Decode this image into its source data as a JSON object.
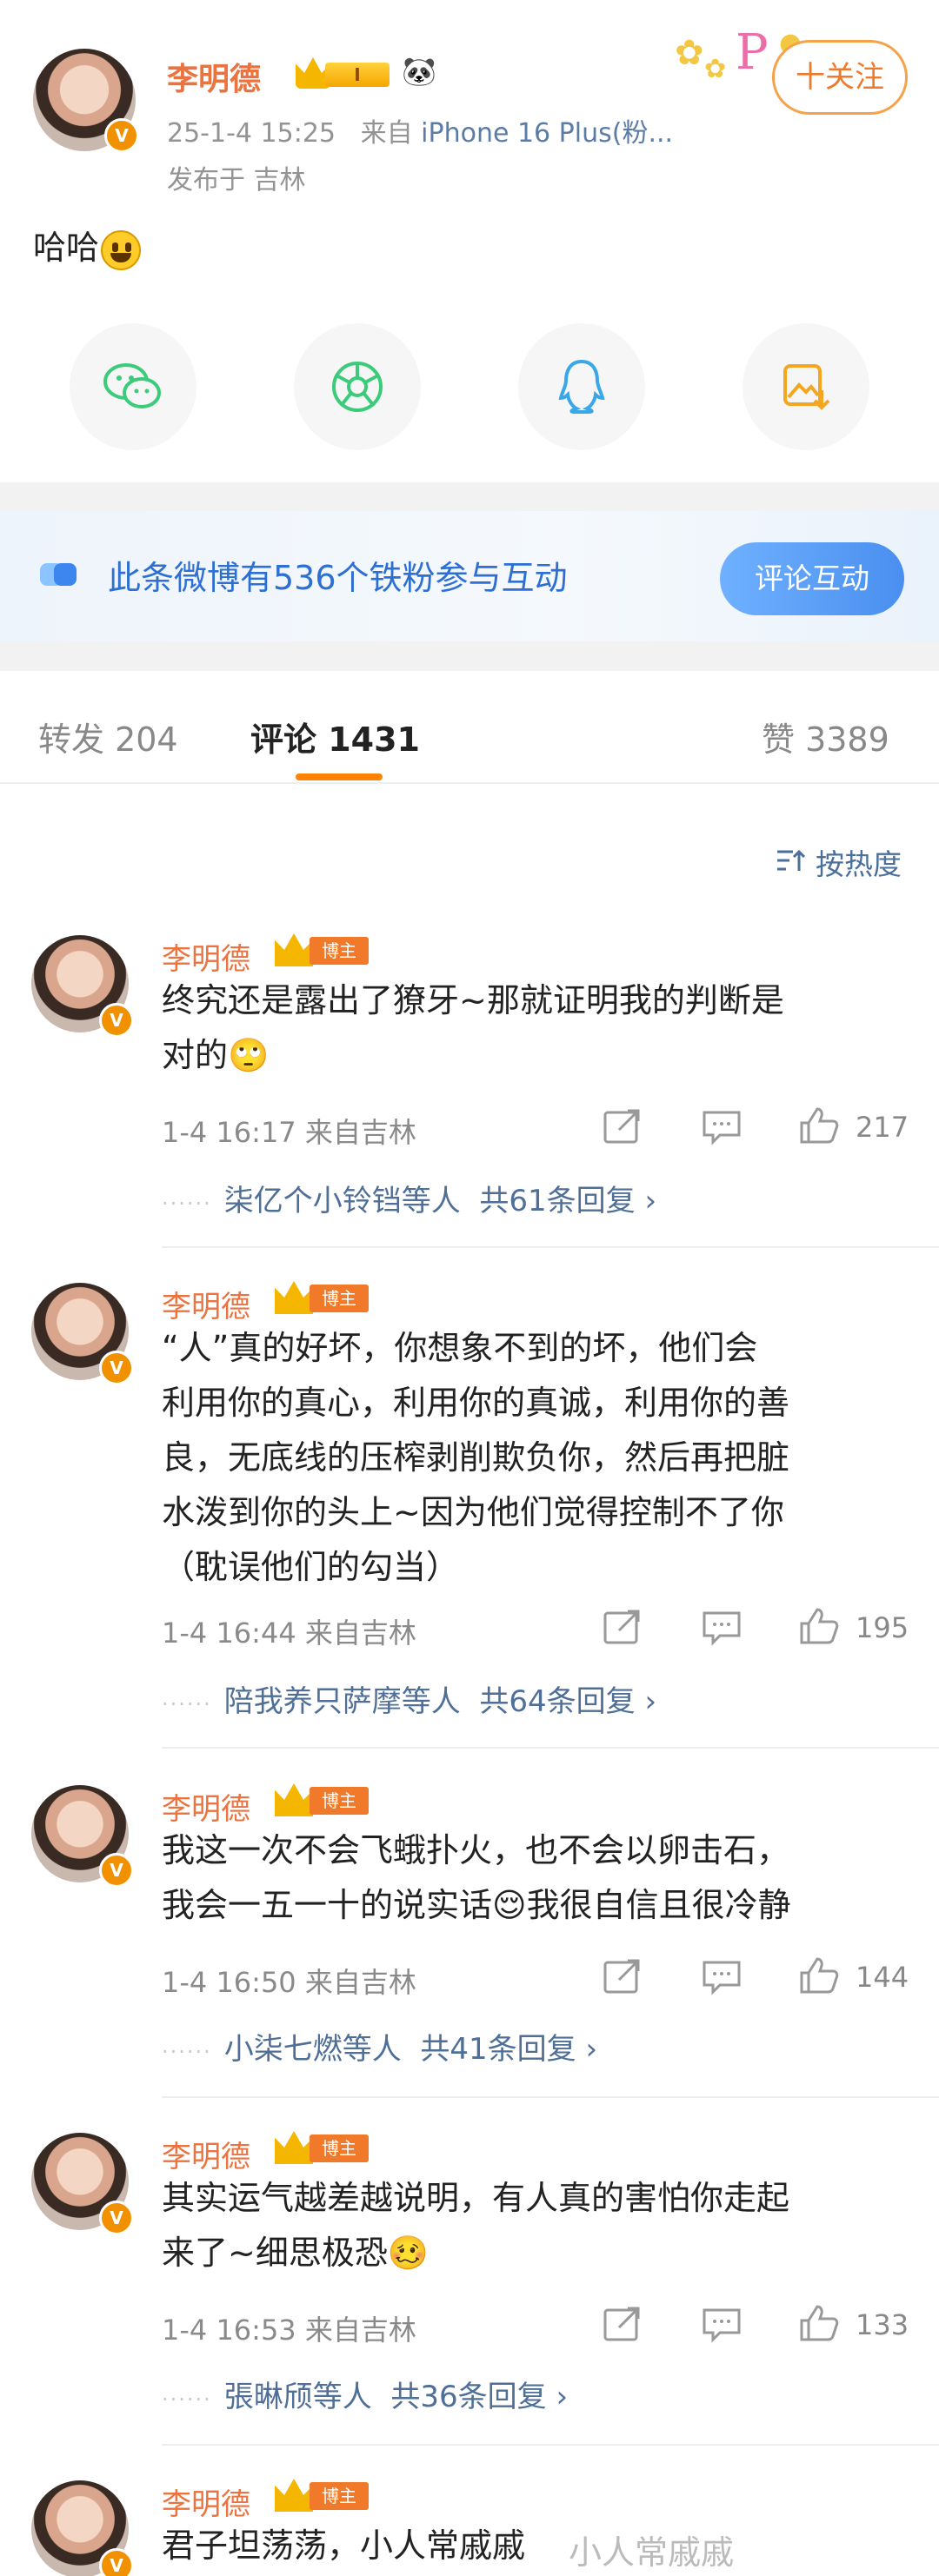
{
  "post": {
    "author": "李明德",
    "badge_level": "I",
    "meta_time": "25-1-4 15:25",
    "meta_from": "来自",
    "meta_device": "iPhone 16 Plus(粉...",
    "location": "发布于 吉林",
    "follow_label": "十关注",
    "text": "哈哈",
    "share_icons": [
      "wechat-icon",
      "moments-icon",
      "qq-icon",
      "save-image-icon"
    ]
  },
  "fan_banner": {
    "text": "此条微博有536个铁粉参与互动",
    "button": "评论互动"
  },
  "tabs": {
    "repost": "转发 204",
    "comment": "评论 1431",
    "like": "赞 3389"
  },
  "sort": {
    "label": "按热度"
  },
  "comments": [
    {
      "name": "李明德",
      "badge": "博主",
      "lines": [
        "终究还是露出了獠牙~那就证明我的判断是",
        "对的🙄"
      ],
      "time": "1-4 16:17 来自吉林",
      "likes": "217",
      "reply_users": "柒亿个小铃铛等人",
      "reply_count": "共61条回复 ›"
    },
    {
      "name": "李明德",
      "badge": "博主",
      "lines": [
        "“人”真的好坏，你想象不到的坏，他们会",
        "利用你的真心，利用你的真诚，利用你的善",
        "良，无底线的压榨剥削欺负你，然后再把脏",
        "水泼到你的头上~因为他们觉得控制不了你",
        "（耽误他们的勾当）"
      ],
      "time": "1-4 16:44 来自吉林",
      "likes": "195",
      "reply_users": "陪我养只萨摩等人",
      "reply_count": "共64条回复 ›"
    },
    {
      "name": "李明德",
      "badge": "博主",
      "lines": [
        "我这一次不会飞蛾扑火，也不会以卵击石，",
        "我会一五一十的说实话😌我很自信且很冷静"
      ],
      "time": "1-4 16:50 来自吉林",
      "likes": "144",
      "reply_users": "小柒七燃等人",
      "reply_count": "共41条回复 ›"
    },
    {
      "name": "李明德",
      "badge": "博主",
      "lines": [
        "其实运气越差越说明，有人真的害怕你走起",
        "来了~细思极恐🥴"
      ],
      "time": "1-4 16:53 来自吉林",
      "likes": "133",
      "reply_users": "張晽颀等人",
      "reply_count": "共36条回复 ›"
    },
    {
      "name": "李明德",
      "badge": "博主",
      "lines": [
        "君子坦荡荡，小人常戚戚"
      ]
    }
  ],
  "watermark": "小人常戚戚",
  "colors": {
    "name_orange": "#eb7340",
    "link_blue": "#4f6f97",
    "accent_orange": "#ff8200",
    "banner_blue": "#2d6fd2"
  }
}
